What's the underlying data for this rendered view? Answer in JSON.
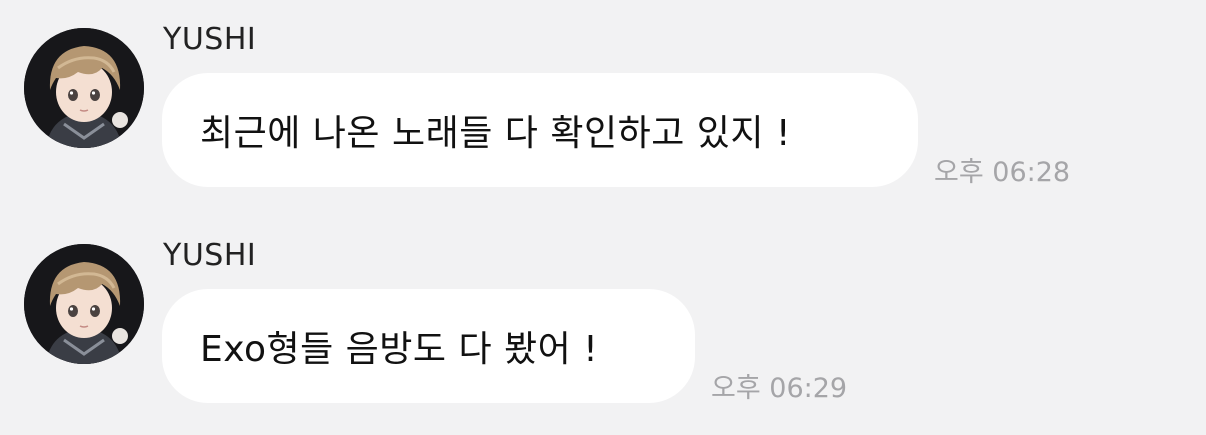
{
  "colors": {
    "background": "#f2f2f3",
    "bubble": "#ffffff",
    "text": "#111111",
    "timestamp": "#a5a5a8"
  },
  "messages": [
    {
      "sender": "YUSHI",
      "avatar_icon": "profile-avatar",
      "text": "최근에 나온 노래들 다 확인하고 있지 !",
      "time": "오후 06:28"
    },
    {
      "sender": "YUSHI",
      "avatar_icon": "profile-avatar",
      "text": "Exo형들 음방도 다 봤어 !",
      "time": "오후 06:29"
    }
  ]
}
